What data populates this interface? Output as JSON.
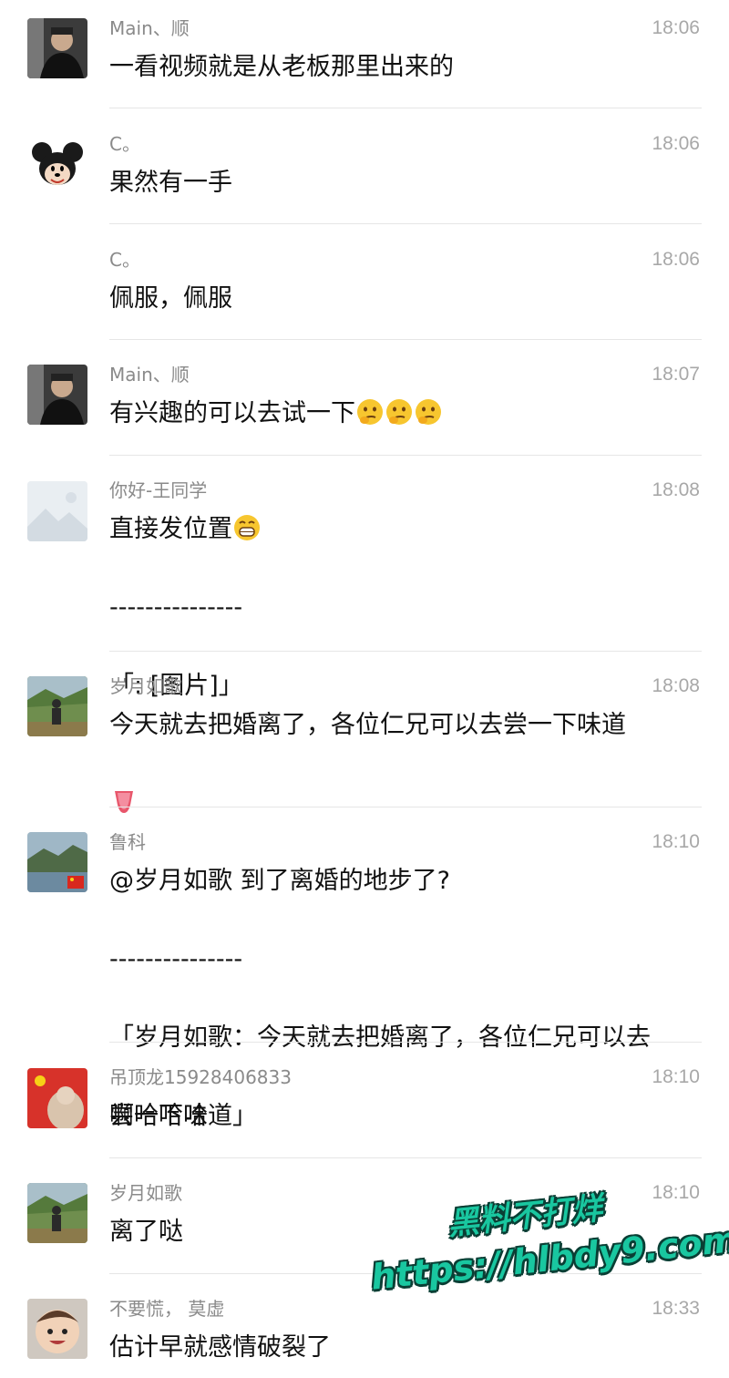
{
  "messages": [
    {
      "name": "Main、顺",
      "time": "18:06",
      "lines": [
        "一看视频就是从老板那里出来的"
      ]
    },
    {
      "name": "C。",
      "time": "18:06",
      "lines": [
        "果然有一手"
      ]
    },
    {
      "name": "C。",
      "time": "18:06",
      "lines": [
        "佩服，佩服"
      ]
    },
    {
      "name": "Main、顺",
      "time": "18:07",
      "lines": [
        "有兴趣的可以去试一下"
      ]
    },
    {
      "name": "你好-王同学",
      "time": "18:08",
      "lines": [
        "直接发位置",
        "---------------",
        "「: [图片]」"
      ]
    },
    {
      "name": "岁月如歌",
      "time": "18:08",
      "lines": [
        "今天就去把婚离了，各位仁兄可以去尝一下味道"
      ]
    },
    {
      "name": "鲁科",
      "time": "18:10",
      "lines": [
        "@岁月如歌 到了离婚的地步了?",
        "---------------",
        "「岁月如歌：今天就去把婚离了，各位仁兄可以去",
        "尝一下味道」"
      ]
    },
    {
      "name": "吊顶龙15928406833",
      "time": "18:10",
      "lines": [
        "啊哈哈哈"
      ]
    },
    {
      "name": "岁月如歌",
      "time": "18:10",
      "lines": [
        "离了哒"
      ]
    },
    {
      "name": "不要慌， 莫虚",
      "time": "18:33",
      "lines": [
        "估计早就感情破裂了"
      ]
    }
  ],
  "watermark": {
    "line1": "黑料不打烊",
    "line2": "https://hlbdy9.com"
  },
  "colors": {
    "accent_watermark": "#19c7a0",
    "name_gray": "#8a8a8a",
    "time_gray": "#a8a8a8"
  }
}
